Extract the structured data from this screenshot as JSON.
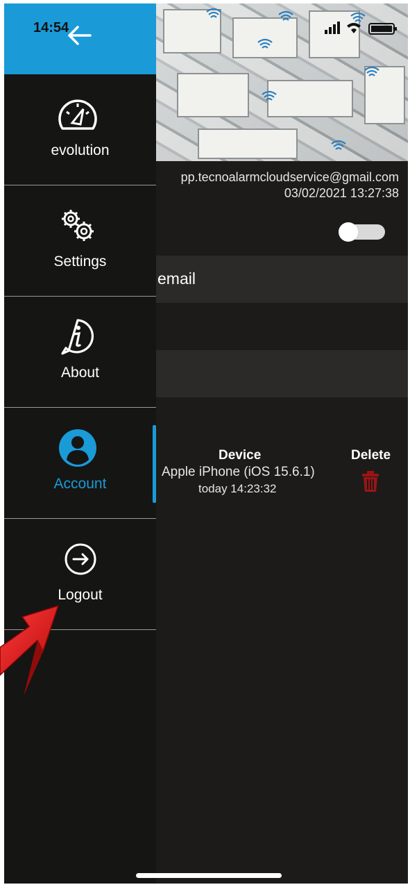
{
  "status_bar": {
    "time": "14:54"
  },
  "drawer": {
    "items": [
      {
        "label": "evolution",
        "icon": "gauge-icon"
      },
      {
        "label": "Settings",
        "icon": "gears-icon"
      },
      {
        "label": "About",
        "icon": "info-icon"
      },
      {
        "label": "Account",
        "icon": "user-avatar-icon",
        "active": true
      },
      {
        "label": "Logout",
        "icon": "logout-icon"
      }
    ]
  },
  "account": {
    "email": "pp.tecnoalarmcloudservice@gmail.com",
    "date": "03/02/2021 13:27:38",
    "field_label": "email",
    "device_header": "Device",
    "delete_header": "Delete",
    "device_name": "Apple iPhone (iOS 15.6.1)",
    "device_time": "today 14:23:32"
  },
  "colors": {
    "accent": "#1b9ad8",
    "background": "#1c1b19",
    "drawer": "#151513",
    "delete": "#9b1414",
    "annotation_arrow": "#e31b1b"
  }
}
